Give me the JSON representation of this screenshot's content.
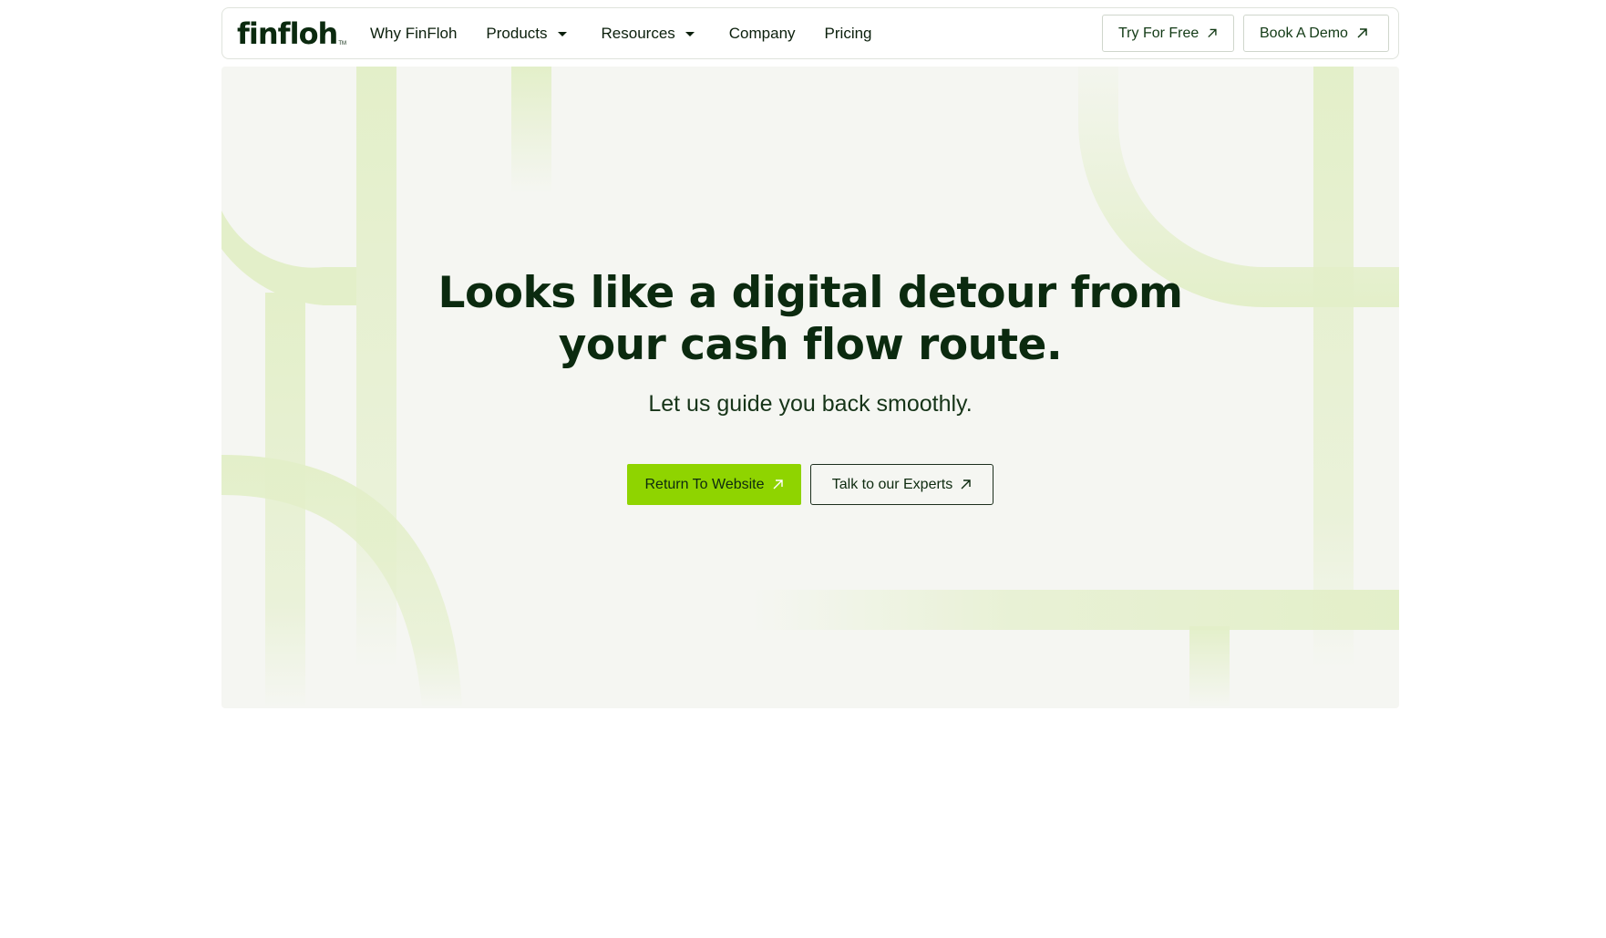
{
  "brand": {
    "logo_text": "finfloh",
    "logo_mark": "TM"
  },
  "nav": {
    "items": [
      {
        "label": "Why FinFloh"
      },
      {
        "label": "Products"
      },
      {
        "label": "Resources"
      },
      {
        "label": "Company"
      },
      {
        "label": "Pricing"
      }
    ],
    "actions": {
      "try_free": "Try For Free",
      "book_demo": "Book A Demo"
    }
  },
  "hero": {
    "headline_line1": "Looks like a digital detour from",
    "headline_line2": "your cash flow route.",
    "subline": "Let us guide you back smoothly.",
    "primary_cta": "Return To Website",
    "secondary_cta": "Talk to our Experts"
  },
  "colors": {
    "brand_dark": "#0b2a0f",
    "accent_green": "#8fd400",
    "hero_bg": "#f5f6f2",
    "decor_green": "#e3efc9"
  },
  "icons": {
    "external_link": "arrow-up-right-icon",
    "dropdown": "caret-down-icon"
  }
}
